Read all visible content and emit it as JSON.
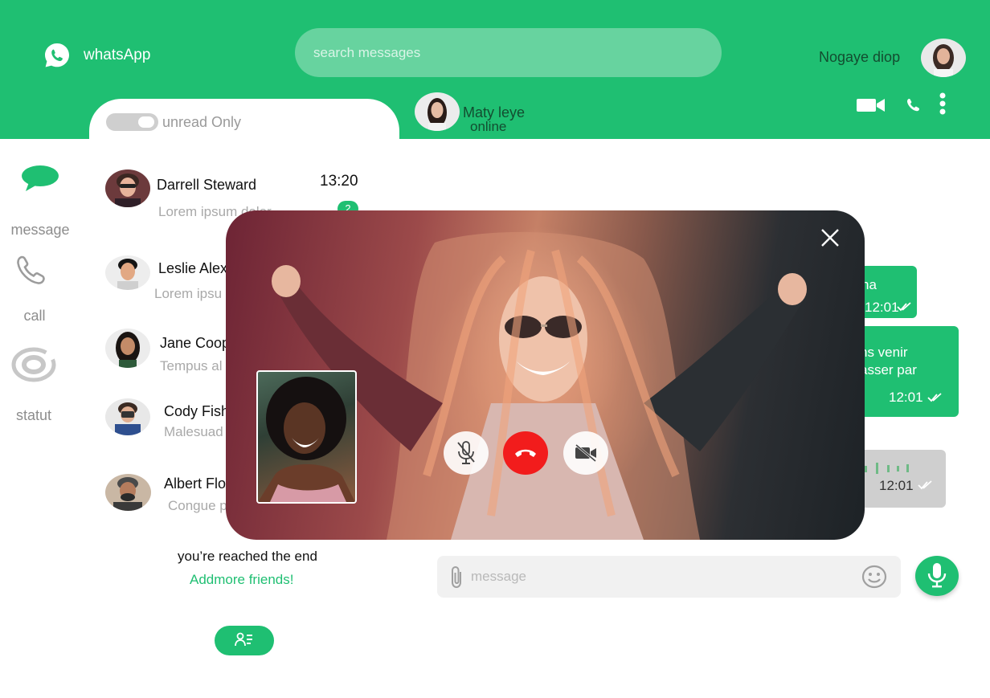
{
  "app": {
    "title": "whatsApp"
  },
  "search": {
    "placeholder": "search messages"
  },
  "user": {
    "name": "Nogaye  diop"
  },
  "filter": {
    "label": "unread Only"
  },
  "chat_header": {
    "name": "Maty leye",
    "status": "online"
  },
  "nav": [
    {
      "label": "message",
      "icon": "message-icon"
    },
    {
      "label": "call",
      "icon": "phone-icon"
    },
    {
      "label": "statut",
      "icon": "status-icon"
    }
  ],
  "conversations": [
    {
      "name": "Darrell Steward",
      "preview": "Lorem ipsum dolor",
      "time": "13:20",
      "unread": "2"
    },
    {
      "name": "Leslie Alex",
      "preview": "Lorem ipsu"
    },
    {
      "name": "Jane Coop",
      "preview": "Tempus al"
    },
    {
      "name": "Cody Fish",
      "preview": "Malesuad"
    },
    {
      "name": "Albert Flo",
      "preview": "Congue p"
    }
  ],
  "list_end": {
    "text": "you’re reached the end",
    "link": "Addmore friends!"
  },
  "messages": [
    {
      "text": "na",
      "time": "12:01"
    },
    {
      "text_line1": "ns venir",
      "text_line2": "asser par",
      "time": "12:01"
    },
    {
      "type": "voice",
      "time": "12:01"
    }
  ],
  "composer": {
    "placeholder": "message"
  },
  "colors": {
    "accent": "#1fbf72",
    "hangup": "#f21c1c",
    "header_text": "#134d30"
  }
}
